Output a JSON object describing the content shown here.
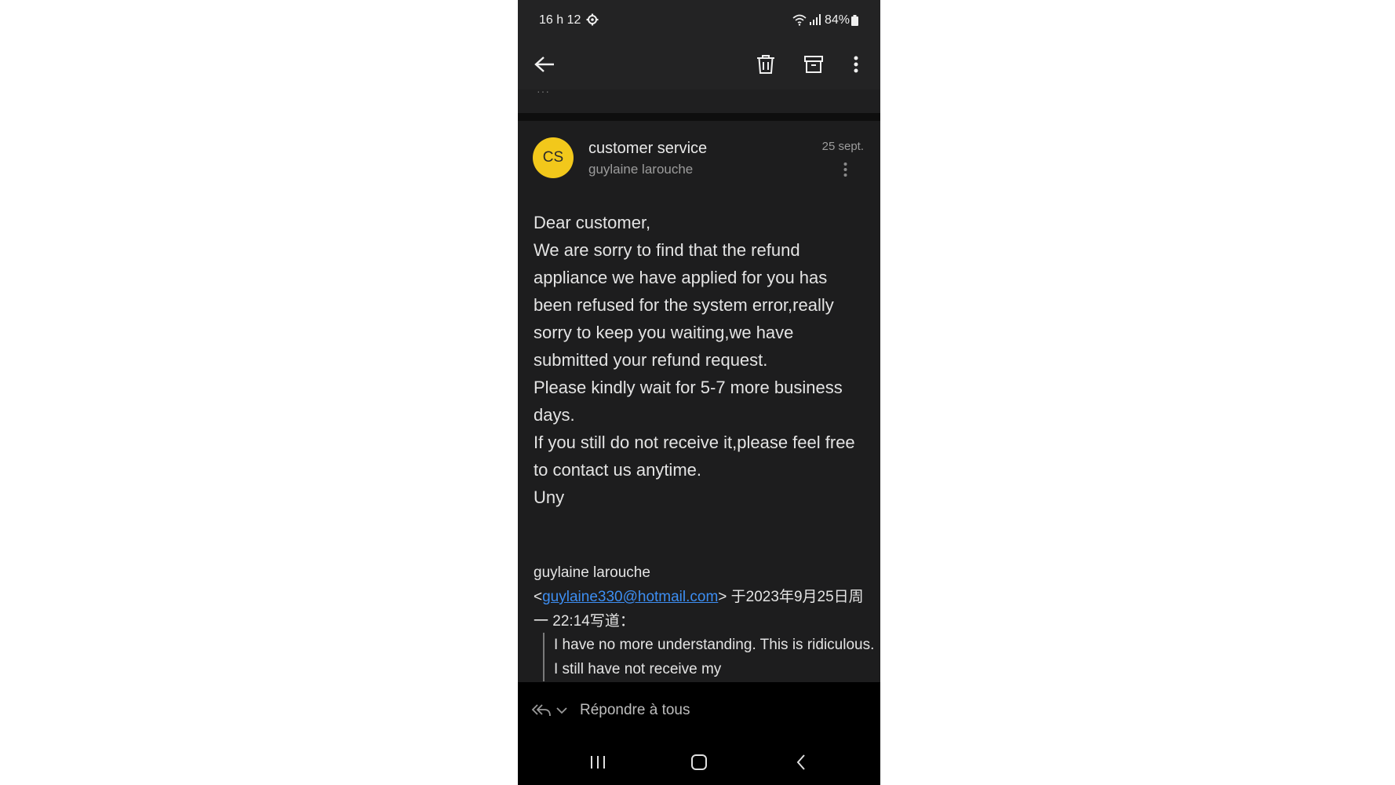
{
  "status_bar": {
    "time": "16 h 12",
    "battery": "84%",
    "icons": [
      "gear-icon",
      "wifi-icon",
      "signal-icon",
      "battery-icon"
    ]
  },
  "toolbar": {
    "icons": [
      "back-arrow-icon",
      "trash-icon",
      "archive-icon",
      "more-vert-icon"
    ]
  },
  "message": {
    "avatar_initials": "CS",
    "avatar_color": "#f2c81b",
    "sender": "customer service",
    "recipient": "guylaine larouche",
    "date": "25 sept.",
    "body": [
      "Dear customer,",
      "We are sorry to find that the refund appliance we have applied for you has been refused for the system error,really sorry to keep you waiting,we have submitted your refund request.",
      "Please kindly wait for 5-7 more business days.",
      "If you still do not receive it,please feel free to contact us anytime.",
      "Uny"
    ],
    "quote_header": {
      "name": "guylaine larouche",
      "open_bracket": "<",
      "email": "guylaine330@hotmail.com",
      "suffix": "> 于2023年9月25日周一 22:14写道："
    },
    "quoted_text": "I have no more understanding. This is ridiculous. I still have not receive my"
  },
  "reply_bar": {
    "label": "Répondre à tous"
  },
  "colors": {
    "background": "#1d1d1e",
    "link": "#3d8ef2"
  }
}
